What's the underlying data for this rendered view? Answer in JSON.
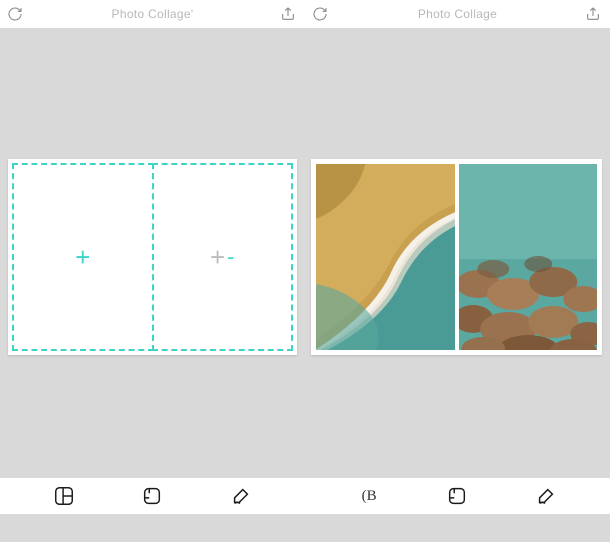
{
  "topbar": {
    "left": {
      "title": "Photo Collage'"
    },
    "right": {
      "title": "Photo Collage"
    }
  },
  "slots": {
    "left_plus": "+",
    "right_plus": "+",
    "right_minus": "-"
  },
  "toolbar": {
    "text_tool": "(B"
  },
  "icons": {
    "refresh": "refresh",
    "share": "share",
    "layout": "layout",
    "frame": "frame",
    "edit": "edit",
    "text": "text"
  }
}
